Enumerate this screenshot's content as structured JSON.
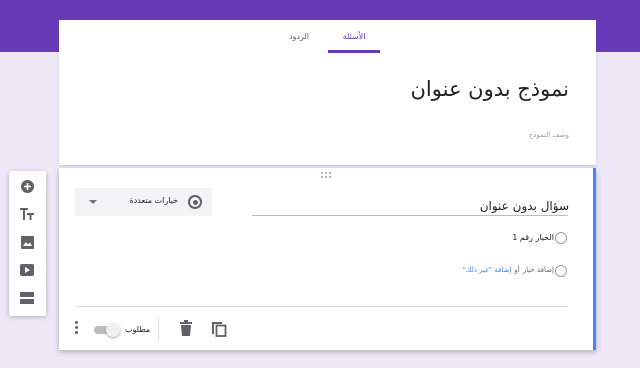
{
  "tabs": {
    "questions": "الأسئلة",
    "responses": "الردود"
  },
  "form": {
    "title": "نموذج بدون عنوان",
    "description_placeholder": "وصف النموذج"
  },
  "question": {
    "title": "سؤال بدون عنوان",
    "type_label": "خيارات متعددة",
    "options": [
      "الخيار رقم 1"
    ],
    "add_option": "إضافة خيار",
    "or": "أو",
    "add_other": "إضافة \"غير ذلك\"",
    "required_label": "مطلوب",
    "required": false
  },
  "side_toolbar": {
    "icons": [
      "add-question-icon",
      "add-title-icon",
      "add-image-icon",
      "add-video-icon",
      "add-section-icon"
    ]
  },
  "colors": {
    "accent": "#673ab7",
    "background": "#ede7f6",
    "active_border": "#4285f4"
  }
}
